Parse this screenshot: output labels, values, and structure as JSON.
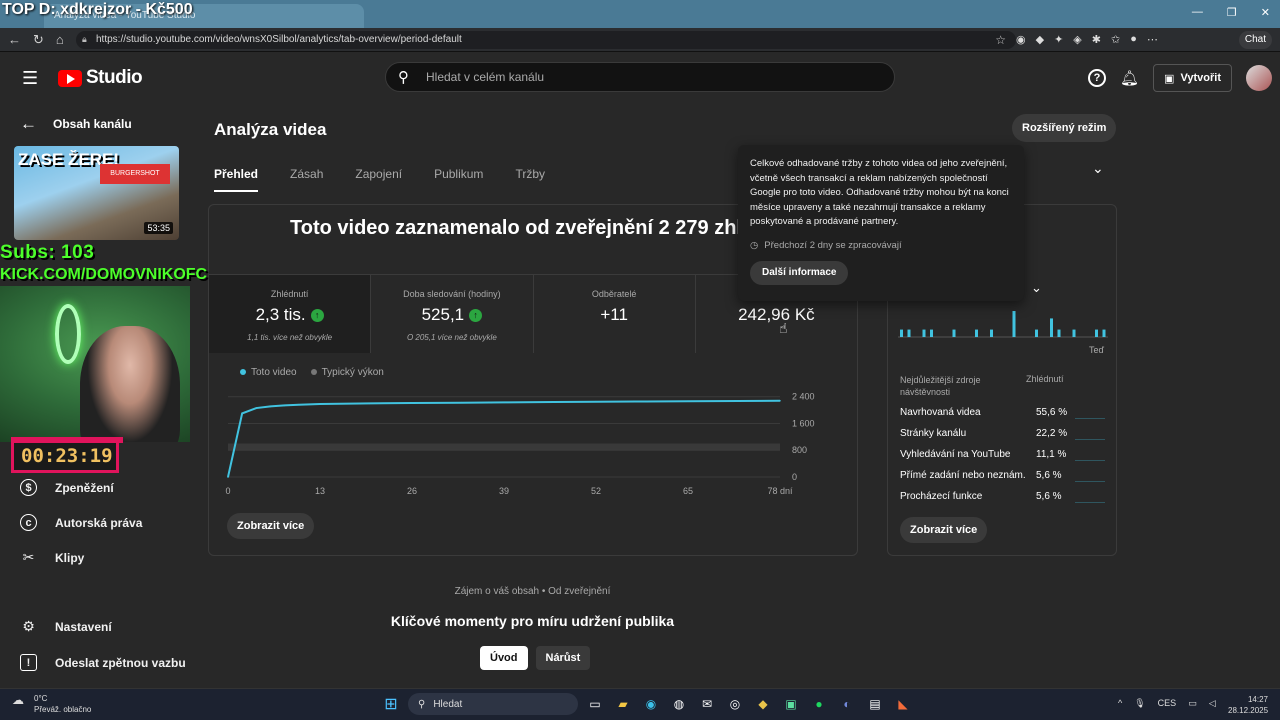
{
  "browser": {
    "tab_title": "Analýza videa - YouTube Studio",
    "url": "https://studio.youtube.com/video/wnsX0Silbol/analytics/tab-overview/period-default",
    "chat_label": "Chat"
  },
  "stream_overlay": {
    "top_text": "TOP D: xdkrejzor - Kč500",
    "subs": "Subs: 103",
    "kick": "KICK.COM/DOMOVNIKOFC",
    "timer": "00:23:19"
  },
  "header": {
    "logo_text": "Studio",
    "search_placeholder": "Hledat v celém kanálu",
    "create_label": "Vytvořit"
  },
  "sidebar": {
    "back_label": "Obsah kanálu",
    "thumb_title": "ZASE ŽERE!",
    "thumb_sign": "BURGERSHOT",
    "thumb_duration": "53:35",
    "items": [
      {
        "label": "Zpeněžení",
        "icon": "dollar-icon"
      },
      {
        "label": "Autorská práva",
        "icon": "copyright-icon"
      },
      {
        "label": "Klipy",
        "icon": "scissors-icon"
      },
      {
        "label": "Nastavení",
        "icon": "gear-icon"
      },
      {
        "label": "Odeslat zpětnou vazbu",
        "icon": "feedback-icon"
      }
    ]
  },
  "main": {
    "title": "Analýza videa",
    "advanced_label": "Rozšířený režim",
    "tabs": [
      "Přehled",
      "Zásah",
      "Zapojení",
      "Publikum",
      "Tržby"
    ],
    "headline": "Toto video zaznamenalo od zveřejnění 2 279 zhlédnutí",
    "metrics": [
      {
        "label": "Zhlédnutí",
        "value": "2,3 tis.",
        "sub": "1,1 tis. více než obvykle",
        "up": true
      },
      {
        "label": "Doba sledování (hodiny)",
        "value": "525,1",
        "sub": "O 205,1 více než obvykle",
        "up": true
      },
      {
        "label": "Odběratelé",
        "value": "+11",
        "sub": "",
        "up": false
      },
      {
        "label": "Od",
        "value": "242,96 Kč",
        "sub": "",
        "up": false
      }
    ],
    "legend": {
      "this_video": "Toto video",
      "typical": "Typický výkon"
    },
    "more_label": "Zobrazit více",
    "interest_text": "Zájem o váš obsah • Od zveřejnění",
    "key_moments_title": "Klíčové momenty pro míru udržení publika",
    "seg_buttons": [
      "Úvod",
      "Nárůst"
    ]
  },
  "chart_data": {
    "type": "line",
    "x": [
      0,
      2,
      4,
      6,
      8,
      10,
      13,
      20,
      26,
      33,
      39,
      46,
      52,
      59,
      65,
      72,
      78
    ],
    "x_ticks": [
      "0",
      "13",
      "26",
      "39",
      "52",
      "65",
      "78 dní"
    ],
    "y_ticks": [
      "2 400",
      "1 600",
      "800",
      "0"
    ],
    "ylim": [
      0,
      2600
    ],
    "series": [
      {
        "name": "Toto video",
        "values": [
          0,
          1900,
          2060,
          2110,
          2140,
          2160,
          2180,
          2200,
          2210,
          2220,
          2230,
          2240,
          2250,
          2258,
          2265,
          2272,
          2279
        ]
      }
    ],
    "typical_band": [
      800,
      1000
    ]
  },
  "side_panel": {
    "period_label": "Teď",
    "spark_values": [
      2,
      2,
      0,
      2,
      2,
      0,
      0,
      2,
      0,
      0,
      2,
      0,
      2,
      0,
      0,
      7,
      0,
      0,
      2,
      0,
      5,
      2,
      0,
      2,
      0,
      0,
      2,
      2
    ],
    "col1_header": "Nejdůležitější zdroje návštěvnosti",
    "col2_header": "Zhlédnutí",
    "sources": [
      {
        "name": "Navrhovaná videa",
        "pct": "55,6 %"
      },
      {
        "name": "Stránky kanálu",
        "pct": "22,2 %"
      },
      {
        "name": "Vyhledávání na YouTube",
        "pct": "11,1 %"
      },
      {
        "name": "Přímé zadání nebo neznám...",
        "pct": "5,6 %"
      },
      {
        "name": "Procházecí funkce",
        "pct": "5,6 %"
      }
    ]
  },
  "tooltip": {
    "text": "Celkové odhadované tržby z tohoto videa od jeho zveřejnění, včetně všech transakcí a reklam nabízených společností Google pro toto video. Odhadované tržby mohou být na konci měsíce upraveny a také nezahrnují transakce a reklamy poskytované a prodávané partnery.",
    "delay": "Předchozí 2 dny se zpracovávají",
    "button": "Další informace"
  },
  "taskbar": {
    "temp": "0°C",
    "weather": "Převáž. oblačno",
    "search": "Hledat",
    "lang": "CES",
    "time": "14:27",
    "date": "28.12.2025"
  }
}
